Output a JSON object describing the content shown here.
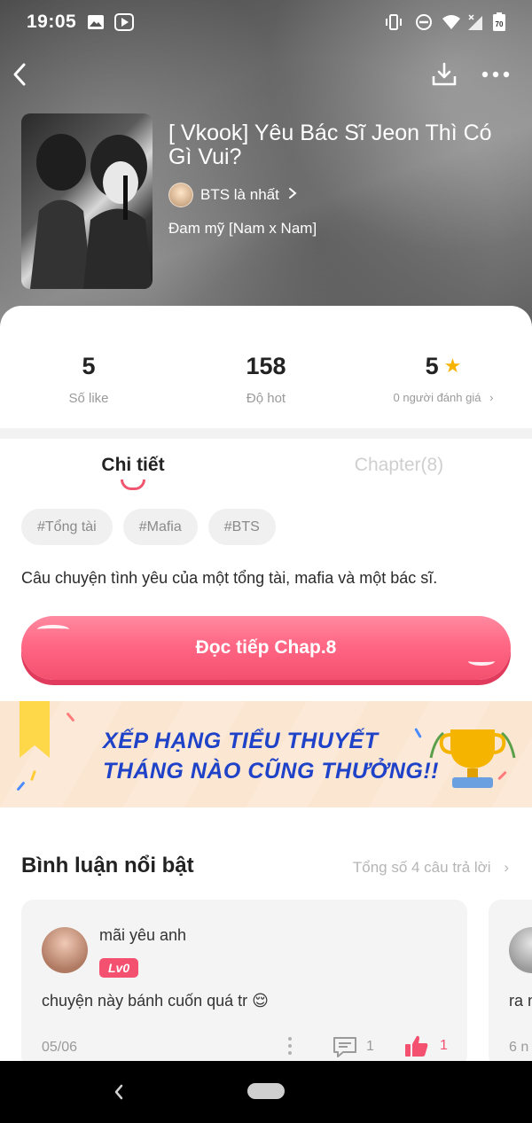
{
  "status_bar": {
    "time": "19:05",
    "battery_level": "70"
  },
  "book": {
    "title": "[ Vkook] Yêu Bác Sĩ Jeon Thì Có Gì Vui?",
    "author": "BTS là nhất",
    "genre": "Đam mỹ [Nam x Nam]"
  },
  "stats": {
    "likes": {
      "value": "5",
      "label": "Số like"
    },
    "hot": {
      "value": "158",
      "label": "Độ hot"
    },
    "rating": {
      "value": "5",
      "label": "0 người đánh giá"
    }
  },
  "tabs": {
    "detail": "Chi tiết",
    "chapter": "Chapter(8)"
  },
  "tags": [
    "#Tổng tài",
    "#Mafia",
    "#BTS"
  ],
  "description": "Câu chuyện tình yêu của một tổng tài, mafia và một bác sĩ.",
  "read_button": "Đọc tiếp Chap.8",
  "banner": {
    "line1": "XẾP HẠNG TIỂU THUYẾT",
    "line2": "THÁNG NÀO CŨNG THƯỞNG!!"
  },
  "comments": {
    "title": "Bình luận nổi bật",
    "total": "Tổng số 4 câu trả lời",
    "items": [
      {
        "user": "mãi yêu anh",
        "level": "Lv0",
        "text": "chuyện này bánh cuốn quá tr 😌",
        "date": "05/06",
        "replies": "1",
        "likes": "1"
      },
      {
        "text": "ra n",
        "date": "6 n"
      }
    ]
  },
  "colors": {
    "accent": "#f4506f",
    "star": "#f6b400",
    "banner_text": "#1f43c8"
  },
  "icons": {
    "back": "back-arrow-icon",
    "download": "download-icon",
    "more": "more-dots-icon",
    "star": "star-icon",
    "reply": "comment-icon",
    "like": "thumbs-up-icon"
  }
}
